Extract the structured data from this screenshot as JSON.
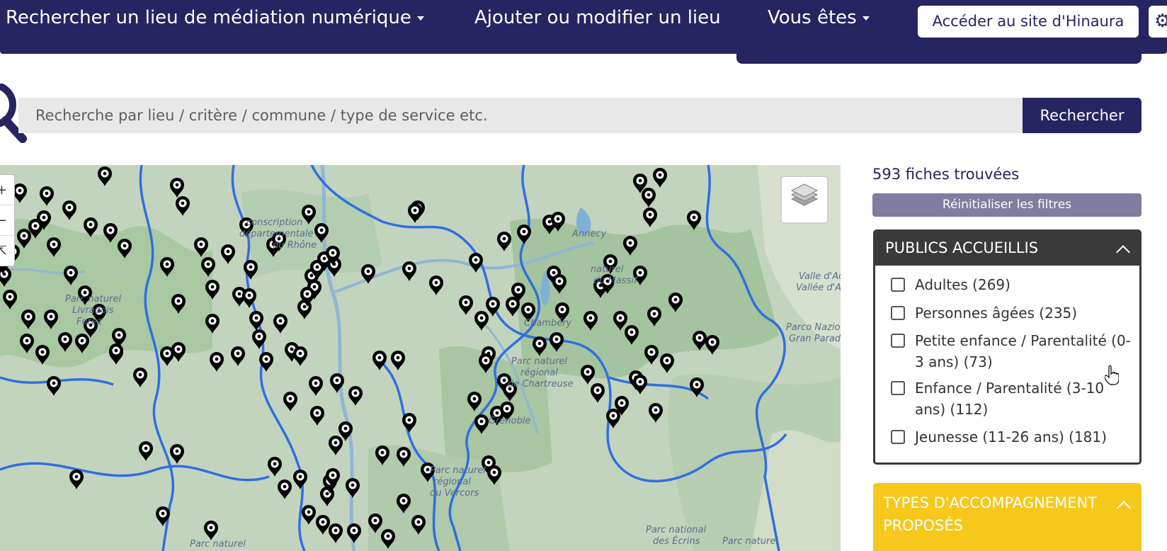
{
  "header": {
    "nav_search": "Rechercher un lieu de médiation numérique",
    "nav_add": "Ajouter ou modifier un lieu",
    "nav_you_are": "Vous êtes",
    "site_button": "Accéder au site d'Hinaura",
    "gear_icon": "gear-icon"
  },
  "search": {
    "placeholder": "Recherche par lieu / critère / commune / type de service etc.",
    "button": "Rechercher"
  },
  "map": {
    "zoom_in": "+",
    "zoom_out": "−",
    "reset_view": "⇱",
    "labels": {
      "conscription": "conscription",
      "departementale": "départementale",
      "du_rhone": "du Rhône",
      "parc_naturel_1": "Parc naturel",
      "livradois": "Livradois",
      "forez": "Forez",
      "annecy": "Annecy",
      "naturel": "naturel",
      "massif": "du Massif",
      "chambery": "Chambéry",
      "pn_regional": "Parc naturel",
      "regional": "régional",
      "chartreuse": "de Chartreuse",
      "grenoble": "Grenoble",
      "pn_vercors_1": "Parc naturel",
      "pn_vercors_2": "régional",
      "pn_vercors_3": "du Vercors",
      "pn_bottom": "Parc naturel",
      "valle_1": "Valle d'Ao",
      "valle_2": "Vallée d'A",
      "parco": "Parco Nazio",
      "gran_para": "Gran Parad",
      "ecrins_1": "Parc national",
      "ecrins_2": "des Écrins",
      "pn_right": "Parc naturel"
    },
    "colors": {
      "water": "#9cc3dd",
      "forest": "#a9c9a4",
      "border": "#2f6fe0",
      "pin": "#000000"
    }
  },
  "sidebar": {
    "results": "593 fiches trouvées",
    "reset": "Réinitialiser les filtres",
    "panel1_title": "PUBLICS ACCUEILLIS",
    "options": [
      {
        "label": "Adultes (269)",
        "checked": false
      },
      {
        "label": "Personnes âgées (235)",
        "checked": false
      },
      {
        "label": "Petite enfance / Parentalité (0-3 ans) (73)",
        "checked": false
      },
      {
        "label": "Enfance / Parentalité (3-10 ans) (112)",
        "checked": false
      },
      {
        "label": "Jeunesse (11-26 ans) (181)",
        "checked": false
      }
    ],
    "panel2_title": "TYPES D'ACCOMPAGNEMENT PROPOSÉS",
    "colors": {
      "navy": "#262461",
      "reset_bg": "#7f7ea0",
      "panel_dark": "#3a3a3a",
      "yellow": "#f6c81b"
    }
  }
}
